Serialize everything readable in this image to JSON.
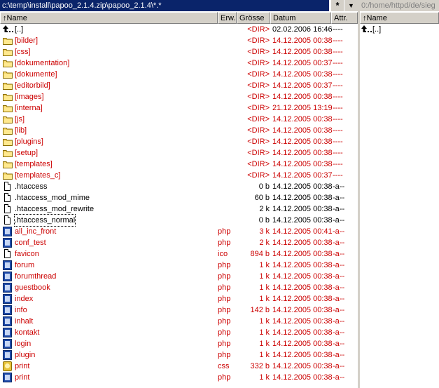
{
  "left_panel": {
    "path": "c:\\temp\\install\\papoo_2.1.4.zip\\papoo_2.1.4\\*.*",
    "history_label": "*",
    "dropdown_label": "▼",
    "columns": {
      "name": "↑Name",
      "ext": "Erw.",
      "size": "Grösse",
      "date": "Datum",
      "attr": "Attr."
    },
    "rows": [
      {
        "icon": "up-dir-icon",
        "name": "[..]",
        "ext": "",
        "size": "<DIR>",
        "date": "02.02.2006 16:46",
        "attr": "----",
        "red": true,
        "name_black": true
      },
      {
        "icon": "folder-icon",
        "name": "[bilder]",
        "ext": "",
        "size": "<DIR>",
        "date": "14.12.2005 00:38",
        "attr": "----",
        "red": true
      },
      {
        "icon": "folder-icon",
        "name": "[css]",
        "ext": "",
        "size": "<DIR>",
        "date": "14.12.2005 00:38",
        "attr": "----",
        "red": true
      },
      {
        "icon": "folder-icon",
        "name": "[dokumentation]",
        "ext": "",
        "size": "<DIR>",
        "date": "14.12.2005 00:37",
        "attr": "----",
        "red": true
      },
      {
        "icon": "folder-icon",
        "name": "[dokumente]",
        "ext": "",
        "size": "<DIR>",
        "date": "14.12.2005 00:38",
        "attr": "----",
        "red": true
      },
      {
        "icon": "folder-icon",
        "name": "[editorbild]",
        "ext": "",
        "size": "<DIR>",
        "date": "14.12.2005 00:37",
        "attr": "----",
        "red": true
      },
      {
        "icon": "folder-icon",
        "name": "[images]",
        "ext": "",
        "size": "<DIR>",
        "date": "14.12.2005 00:38",
        "attr": "----",
        "red": true
      },
      {
        "icon": "folder-icon",
        "name": "[interna]",
        "ext": "",
        "size": "<DIR>",
        "date": "21.12.2005 13:19",
        "attr": "----",
        "red": true
      },
      {
        "icon": "folder-icon",
        "name": "[js]",
        "ext": "",
        "size": "<DIR>",
        "date": "14.12.2005 00:38",
        "attr": "----",
        "red": true
      },
      {
        "icon": "folder-icon",
        "name": "[lib]",
        "ext": "",
        "size": "<DIR>",
        "date": "14.12.2005 00:38",
        "attr": "----",
        "red": true
      },
      {
        "icon": "folder-icon",
        "name": "[plugins]",
        "ext": "",
        "size": "<DIR>",
        "date": "14.12.2005 00:38",
        "attr": "----",
        "red": true
      },
      {
        "icon": "folder-icon",
        "name": "[setup]",
        "ext": "",
        "size": "<DIR>",
        "date": "14.12.2005 00:38",
        "attr": "----",
        "red": true
      },
      {
        "icon": "folder-icon",
        "name": "[templates]",
        "ext": "",
        "size": "<DIR>",
        "date": "14.12.2005 00:38",
        "attr": "----",
        "red": true
      },
      {
        "icon": "folder-icon",
        "name": "[templates_c]",
        "ext": "",
        "size": "<DIR>",
        "date": "14.12.2005 00:37",
        "attr": "----",
        "red": true
      },
      {
        "icon": "file-icon",
        "name": ".htaccess",
        "ext": "",
        "size": "0 b",
        "date": "14.12.2005 00:38",
        "attr": "-a--",
        "red": false
      },
      {
        "icon": "file-icon",
        "name": ".htaccess_mod_mime",
        "ext": "",
        "size": "60 b",
        "date": "14.12.2005 00:38",
        "attr": "-a--",
        "red": false
      },
      {
        "icon": "file-icon",
        "name": ".htaccess_mod_rewrite",
        "ext": "",
        "size": "2 k",
        "date": "14.12.2005 00:38",
        "attr": "-a--",
        "red": false
      },
      {
        "icon": "file-icon",
        "name": ".htaccess_normal",
        "ext": "",
        "size": "0 b",
        "date": "14.12.2005 00:38",
        "attr": "-a--",
        "red": false,
        "focus": true
      },
      {
        "icon": "php-file-icon",
        "name": "all_inc_front",
        "ext": "php",
        "size": "3 k",
        "date": "14.12.2005 00:41",
        "attr": "-a--",
        "red": true
      },
      {
        "icon": "php-file-icon",
        "name": "conf_test",
        "ext": "php",
        "size": "2 k",
        "date": "14.12.2005 00:38",
        "attr": "-a--",
        "red": true
      },
      {
        "icon": "file-icon",
        "name": "favicon",
        "ext": "ico",
        "size": "894 b",
        "date": "14.12.2005 00:38",
        "attr": "-a--",
        "red": true
      },
      {
        "icon": "php-file-icon",
        "name": "forum",
        "ext": "php",
        "size": "1 k",
        "date": "14.12.2005 00:38",
        "attr": "-a--",
        "red": true
      },
      {
        "icon": "php-file-icon",
        "name": "forumthread",
        "ext": "php",
        "size": "1 k",
        "date": "14.12.2005 00:38",
        "attr": "-a--",
        "red": true
      },
      {
        "icon": "php-file-icon",
        "name": "guestbook",
        "ext": "php",
        "size": "1 k",
        "date": "14.12.2005 00:38",
        "attr": "-a--",
        "red": true
      },
      {
        "icon": "php-file-icon",
        "name": "index",
        "ext": "php",
        "size": "1 k",
        "date": "14.12.2005 00:38",
        "attr": "-a--",
        "red": true
      },
      {
        "icon": "php-file-icon",
        "name": "info",
        "ext": "php",
        "size": "142 b",
        "date": "14.12.2005 00:38",
        "attr": "-a--",
        "red": true
      },
      {
        "icon": "php-file-icon",
        "name": "inhalt",
        "ext": "php",
        "size": "1 k",
        "date": "14.12.2005 00:38",
        "attr": "-a--",
        "red": true
      },
      {
        "icon": "php-file-icon",
        "name": "kontakt",
        "ext": "php",
        "size": "1 k",
        "date": "14.12.2005 00:38",
        "attr": "-a--",
        "red": true
      },
      {
        "icon": "php-file-icon",
        "name": "login",
        "ext": "php",
        "size": "1 k",
        "date": "14.12.2005 00:38",
        "attr": "-a--",
        "red": true
      },
      {
        "icon": "php-file-icon",
        "name": "plugin",
        "ext": "php",
        "size": "1 k",
        "date": "14.12.2005 00:38",
        "attr": "-a--",
        "red": true
      },
      {
        "icon": "css-file-icon",
        "name": "print",
        "ext": "css",
        "size": "332 b",
        "date": "14.12.2005 00:38",
        "attr": "-a--",
        "red": true
      },
      {
        "icon": "php-file-icon",
        "name": "print",
        "ext": "php",
        "size": "1 k",
        "date": "14.12.2005 00:38",
        "attr": "-a--",
        "red": true
      }
    ]
  },
  "right_panel": {
    "path": "0:/home/httpd/de/sieg",
    "column_name": "↑Name",
    "rows": [
      {
        "icon": "up-dir-icon",
        "name": "[..]"
      }
    ]
  },
  "colors": {
    "path_active_bg": "#0a246a",
    "highlight_red": "#cc0000",
    "panel_bg": "#d4d0c8"
  }
}
